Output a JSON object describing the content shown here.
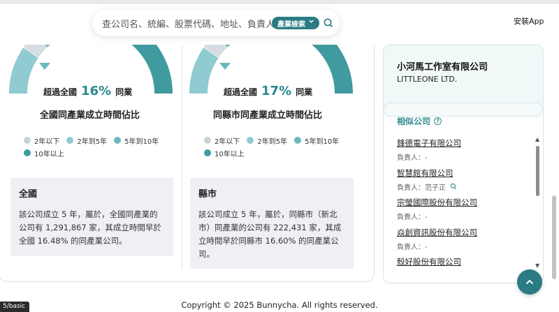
{
  "search": {
    "placeholder": "查公司名、統編、股票代碼、地址、負責人",
    "category_label": "產業檢索"
  },
  "header": {
    "install_label": "安裝App"
  },
  "national": {
    "prefix": "超過全國",
    "percent": "16%",
    "suffix": "同業",
    "title": "全國同產業成立時間佔比",
    "box_title": "全國",
    "box_text": "該公司成立 5 年，屬於，全國同產業的公司有 1,291,867 家，其成立時間早於全國 16.48% 的同產業公司。"
  },
  "county": {
    "prefix": "超過全國",
    "percent": "17%",
    "suffix": "同業",
    "title": "同縣市同產業成立時間佔比",
    "box_title": "縣市",
    "box_text": "該公司成立 5 年，屬於，同縣市（新北市）同產業的公司有 222,431 家，其成立時間早於同縣市 16.60% 的同產業公司。"
  },
  "legend": {
    "items": [
      "2年以下",
      "2年到5年",
      "5年到10年",
      "10年以上"
    ],
    "colors": [
      "#c6d2d6",
      "#8fcbd0",
      "#6cb9bd",
      "#3f9b9f"
    ]
  },
  "company": {
    "name": "小河馬工作室有限公司",
    "name_en": "LITTLEONE LTD."
  },
  "similar": {
    "title": "相似公司",
    "help_icon": "?",
    "items": [
      {
        "name": "鋒德電子有限公司",
        "person": "負責人：-"
      },
      {
        "name": "智慧館有限公司",
        "person": "負責人：范子正"
      },
      {
        "name": "宗瑩國際股份有限公司",
        "person": "負責人：-"
      },
      {
        "name": "焱創資訊股份有限公司",
        "person": "負責人：-"
      },
      {
        "name": "殼好股份有限公司",
        "person": ""
      }
    ]
  },
  "status_chip": "5/basic",
  "footer": {
    "copyright": "Copyright © 2025 Bunnycha. All rights reserved."
  }
}
